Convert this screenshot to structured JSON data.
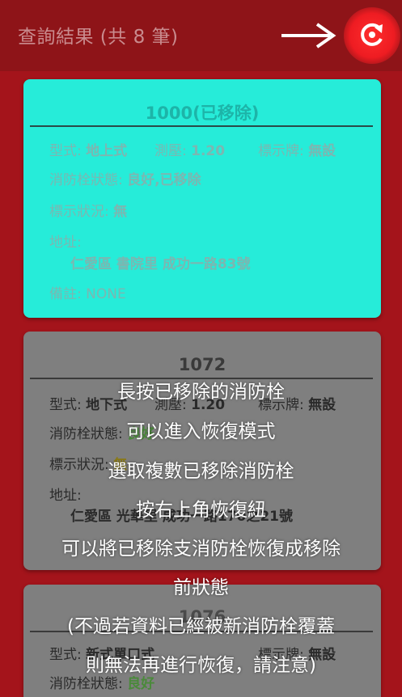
{
  "header": {
    "title": "查詢結果 (共 8 筆)",
    "action_icon": "refresh-icon",
    "arrow_icon": "right-arrow-icon"
  },
  "cards": [
    {
      "code": "1000(已移除)",
      "type_label": "型式:",
      "type_value": "地上式",
      "pressure_label": "測壓:",
      "pressure_value": "1.20",
      "sign_label": "標示牌:",
      "sign_value": "無設",
      "status_label": "消防栓狀態:",
      "status_value": "良好,已移除",
      "sign_status_label": "標示狀況:",
      "sign_status_value": "無",
      "address_label": "地址:",
      "address_value": "仁愛區 書院里 成功一路83號",
      "note_label": "備註:",
      "note_value": "NONE"
    },
    {
      "code": "1072",
      "type_label": "型式:",
      "type_value": "地下式",
      "pressure_label": "測壓:",
      "pressure_value": "1.20",
      "sign_label": "標示牌:",
      "sign_value": "無設",
      "status_label": "消防栓狀態:",
      "status_value": "良好",
      "sign_status_label": "標示狀況:",
      "sign_status_value": "無",
      "address_label": "地址:",
      "address_value": "仁愛區 光華里 成功一路170之21號"
    },
    {
      "code": "1076",
      "type_label": "型式:",
      "type_value": "新式單口式",
      "sign_label": "標示牌:",
      "sign_value": "無設",
      "status_label": "消防栓狀態:",
      "status_value": "良好"
    }
  ],
  "overlay_lines": [
    "長按已移除的消防栓",
    "可以進入恢復模式",
    "選取複數已移除消防栓",
    "按右上角恢復紐",
    "可以將已移除支消防栓恢復成移除",
    "前狀態",
    "(不過若資料已經被新消防栓覆蓋",
    "則無法再進行恢復，請注意)"
  ],
  "colors": {
    "appbar": "#8e1418",
    "background": "#a4141b",
    "selected_card": "#26ecd9",
    "dimmed_card": "#7f7f7f",
    "refresh_button": "#ee1c22"
  }
}
